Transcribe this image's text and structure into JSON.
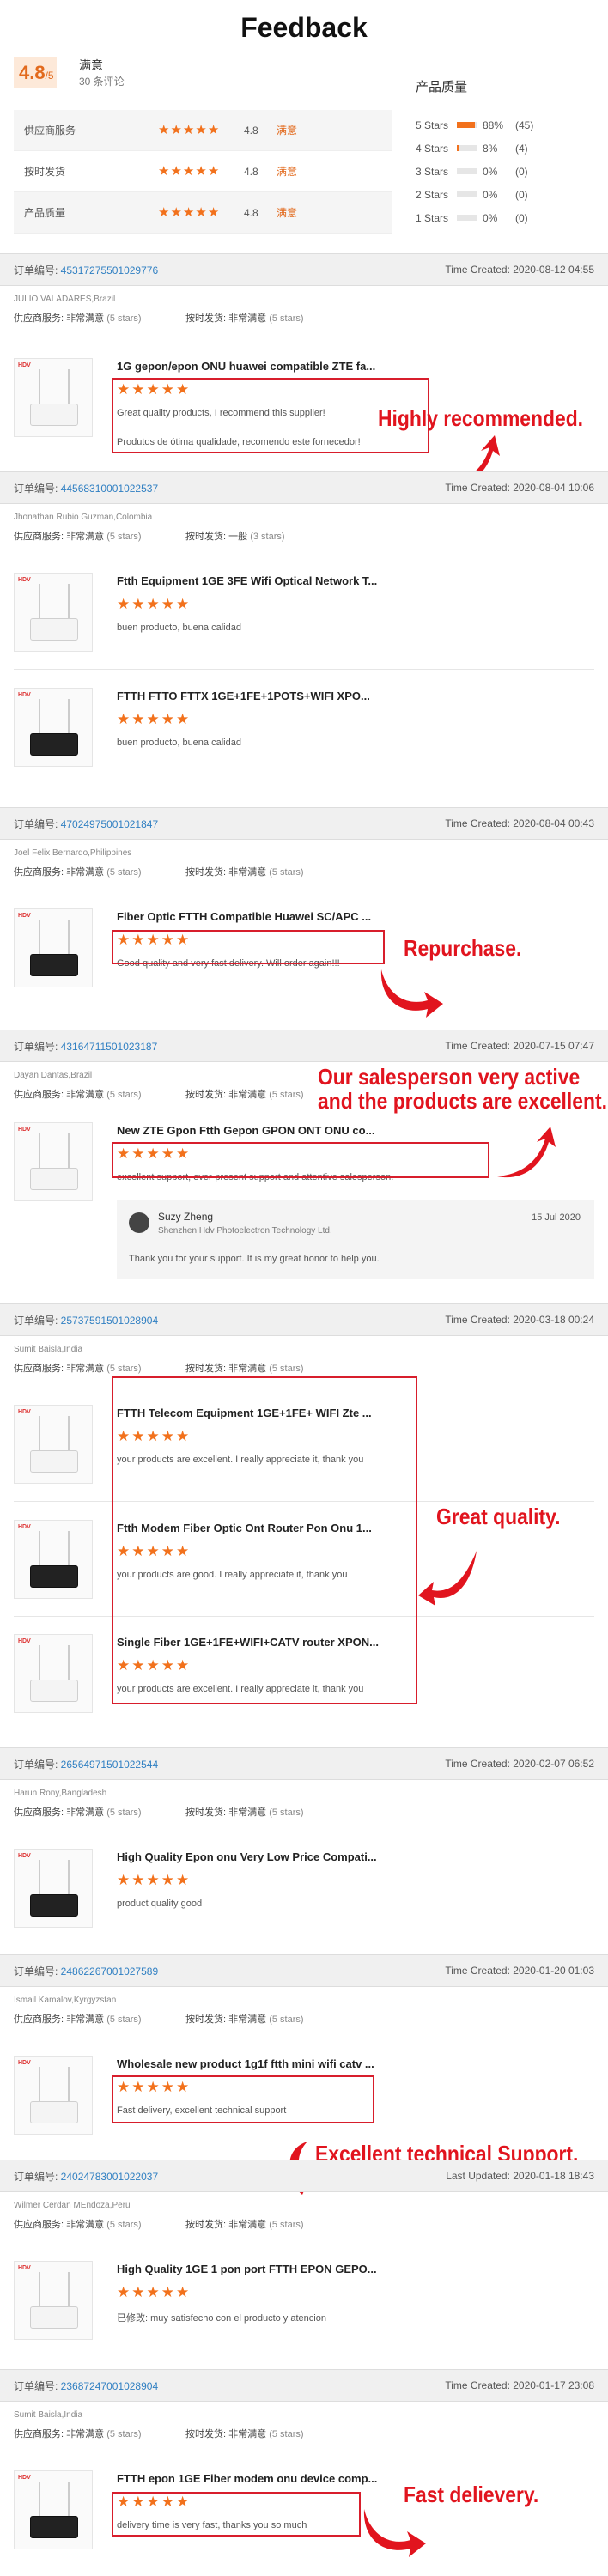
{
  "page_title": "Feedback",
  "summary": {
    "score": "4.8",
    "score_suffix": "/5",
    "satisfaction": "满意",
    "review_count": "30 条评论",
    "ratings": [
      {
        "label": "供应商服务",
        "value": "4.8",
        "word": "满意"
      },
      {
        "label": "按时发货",
        "value": "4.8",
        "word": "满意"
      },
      {
        "label": "产品质量",
        "value": "4.8",
        "word": "满意"
      }
    ],
    "quality_title": "产品质量",
    "distribution": [
      {
        "label": "5 Stars",
        "percent": 88,
        "pct_text": "88%",
        "count": "(45)"
      },
      {
        "label": "4 Stars",
        "percent": 8,
        "pct_text": "8%",
        "count": "(4)"
      },
      {
        "label": "3 Stars",
        "percent": 0,
        "pct_text": "0%",
        "count": "(0)"
      },
      {
        "label": "2 Stars",
        "percent": 0,
        "pct_text": "0%",
        "count": "(0)"
      },
      {
        "label": "1 Stars",
        "percent": 0,
        "pct_text": "0%",
        "count": "(0)"
      }
    ]
  },
  "labels": {
    "order_no": "订单编号: ",
    "time_created": "Time Created: ",
    "last_updated": "Last Updated: ",
    "supplier_service": "供应商服务: ",
    "on_time": "按时发货: ",
    "very_satisfied": "非常满意",
    "general": "一般",
    "five_stars": "(5 stars)",
    "three_stars": "(3 stars)"
  },
  "orders": [
    {
      "order_no": "45317275501029776",
      "time": "Time Created: 2020-08-12 04:55",
      "buyer": "JULIO VALADARES,Brazil",
      "delivery_word": "非常满意",
      "delivery_stars": "(5 stars)",
      "items": [
        {
          "title": "1G gepon/epon ONU huawei compatible ZTE fa...",
          "comment": "Great quality products, I recommend this supplier!",
          "comment2": "Produtos de ótima qualidade, recomendo este fornecedor!"
        }
      ],
      "annotation": "Highly recommended."
    },
    {
      "order_no": "44568310001022537",
      "time": "Time Created: 2020-08-04 10:06",
      "buyer": "Jhonathan Rubio Guzman,Colombia",
      "delivery_word": "一般",
      "delivery_stars": "(3 stars)",
      "items": [
        {
          "title": "Ftth Equipment 1GE 3FE Wifi Optical Network T...",
          "comment": "buen producto, buena calidad"
        },
        {
          "title": "FTTH FTTO FTTX 1GE+1FE+1POTS+WIFI XPO...",
          "comment": "buen producto, buena calidad"
        }
      ]
    },
    {
      "order_no": "47024975001021847",
      "time": "Time Created: 2020-08-04 00:43",
      "buyer": "Joel Felix Bernardo,Philippines",
      "delivery_word": "非常满意",
      "delivery_stars": "(5 stars)",
      "items": [
        {
          "title": "Fiber Optic FTTH Compatible Huawei SC/APC ...",
          "comment": "Good quality and very fast delivery. Will order again!!!"
        }
      ],
      "annotation": "Repurchase."
    },
    {
      "order_no": "43164711501023187",
      "time": "Time Created: 2020-07-15 07:47",
      "buyer": "Dayan Dantas,Brazil",
      "delivery_word": "非常满意",
      "delivery_stars": "(5 stars)",
      "items": [
        {
          "title": "New ZTE Gpon Ftth Gepon GPON ONT ONU co...",
          "comment": "excellent support, ever-present support and attentive salesperson."
        }
      ],
      "annotation_line1": "Our salesperson very active",
      "annotation_line2": "and the products are excellent.",
      "reply": {
        "name": "Suzy Zheng",
        "company": "Shenzhen Hdv Photoelectron Technology Ltd.",
        "date": "15 Jul 2020",
        "text": "Thank you for your support. It is my great honor to help you."
      }
    },
    {
      "order_no": "25737591501028904",
      "time": "Time Created: 2020-03-18 00:24",
      "buyer": "Sumit Baisla,India",
      "delivery_word": "非常满意",
      "delivery_stars": "(5 stars)",
      "items": [
        {
          "title": "FTTH Telecom Equipment 1GE+1FE+ WIFI Zte ...",
          "comment": "your products are excellent. I really appreciate it, thank you"
        },
        {
          "title": "Ftth Modem Fiber Optic Ont Router Pon Onu 1...",
          "comment": "your products are good. I really appreciate it, thank you"
        },
        {
          "title": "Single Fiber 1GE+1FE+WIFI+CATV router XPON...",
          "comment": "your products are excellent. I really appreciate it, thank you"
        }
      ],
      "annotation": "Great quality."
    },
    {
      "order_no": "26564971501022544",
      "time": "Time Created: 2020-02-07 06:52",
      "buyer": "Harun Rony,Bangladesh",
      "delivery_word": "非常满意",
      "delivery_stars": "(5 stars)",
      "items": [
        {
          "title": "High Quality Epon onu Very Low Price Compati...",
          "comment": "product quality good"
        }
      ]
    },
    {
      "order_no": "24862267001027589",
      "time": "Time Created: 2020-01-20 01:03",
      "buyer": "Ismail Kamalov,Kyrgyzstan",
      "delivery_word": "非常满意",
      "delivery_stars": "(5 stars)",
      "items": [
        {
          "title": "Wholesale new product 1g1f ftth mini wifi catv ...",
          "comment": "Fast delivery, excellent technical support"
        }
      ],
      "annotation": "Excellent technical Support."
    },
    {
      "order_no": "24024783001022037",
      "time": "Last Updated: 2020-01-18 18:43",
      "buyer": "Wilmer Cerdan MEndoza,Peru",
      "delivery_word": "非常满意",
      "delivery_stars": "(5 stars)",
      "items": [
        {
          "title": "High Quality 1GE 1 pon port FTTH EPON GEPO...",
          "comment": "已修改: muy satisfecho con el producto y atencion"
        }
      ]
    },
    {
      "order_no": "23687247001028904",
      "time": "Time Created: 2020-01-17 23:08",
      "buyer": "Sumit Baisla,India",
      "delivery_word": "非常满意",
      "delivery_stars": "(5 stars)",
      "items": [
        {
          "title": "FTTH epon 1GE Fiber modem onu device comp...",
          "comment": "delivery time is very fast, thanks you so much"
        }
      ],
      "annotation": "Fast delievery."
    }
  ],
  "colors": {
    "accent": "#f2711c",
    "annotation_red": "#e1141e",
    "link_blue": "#2f7fc2"
  },
  "icons": {
    "star": "star-icon",
    "arrow": "red-curved-arrow-icon"
  }
}
